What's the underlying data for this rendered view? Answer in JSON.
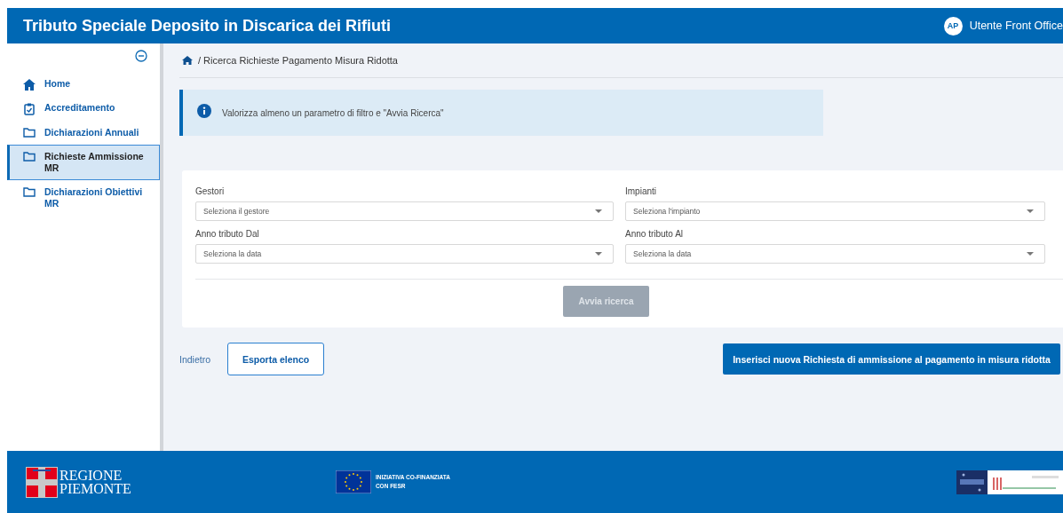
{
  "header": {
    "title": "Tributo Speciale Deposito in Discarica dei Rifiuti",
    "user_initials": "AP",
    "user_name": "Utente Front Office"
  },
  "sidebar": {
    "items": [
      {
        "label": "Home",
        "kind": "home",
        "selected": false
      },
      {
        "label": "Accreditamento",
        "kind": "clipboard",
        "selected": false
      },
      {
        "label": "Dichiarazioni Annuali",
        "kind": "folder",
        "selected": false
      },
      {
        "label": "Richieste Ammissione MR",
        "kind": "folder",
        "selected": true
      },
      {
        "label": "Dichiarazioni Obiettivi MR",
        "kind": "folder",
        "selected": false
      }
    ]
  },
  "breadcrumb": "/ Ricerca Richieste Pagamento Misura Ridotta",
  "info_message": "Valorizza almeno un parametro di filtro e \"Avvia Ricerca\"",
  "filters": [
    {
      "label": "Gestori",
      "placeholder": "Seleziona il gestore"
    },
    {
      "label": "Impianti",
      "placeholder": "Seleziona l'impianto"
    },
    {
      "label": "Anno tributo Dal",
      "placeholder": "Seleziona la data"
    },
    {
      "label": "Anno tributo Al",
      "placeholder": "Seleziona la data"
    }
  ],
  "search_button": {
    "label": "Avvia ricerca",
    "disabled": true
  },
  "back_link": "Indietro",
  "export_button": "Esporta elenco",
  "new_button": "Inserisci nuova Richiesta di ammissione al pagamento in misura ridotta",
  "footer": {
    "region_logo": [
      "REGIONE",
      "PIEMONTE"
    ],
    "eu_text": [
      "INIZIATIVA CO-FINANZIATA",
      "CON FESR"
    ]
  }
}
